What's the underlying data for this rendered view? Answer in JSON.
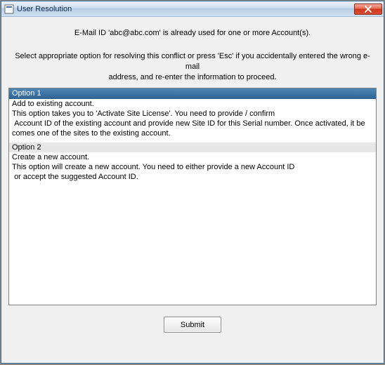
{
  "window": {
    "title": "User Resolution"
  },
  "messages": {
    "line1": "E-Mail ID 'abc@abc.com' is already used  for one or more Account(s).",
    "line2a": "Select appropriate option for resolving this conflict or press 'Esc' if you accidentally entered the wrong e-mail",
    "line2b": "address, and re-enter the information to proceed."
  },
  "options": [
    {
      "header": "Option 1",
      "sel": true,
      "l1": "Add to existing account.",
      "l2": "This option takes you to 'Activate Site License'. You need to provide / confirm",
      "l3": " Account ID of the existing account and provide new Site ID for this Serial number. Once activated, it be comes one of the sites to the existing account."
    },
    {
      "header": "Option 2",
      "sel": false,
      "l1": "Create a new account.",
      "l2": "This option will create a new account. You need to either provide a new Account ID",
      "l3": " or accept the suggested Account ID."
    }
  ],
  "buttons": {
    "submit": "Submit"
  }
}
